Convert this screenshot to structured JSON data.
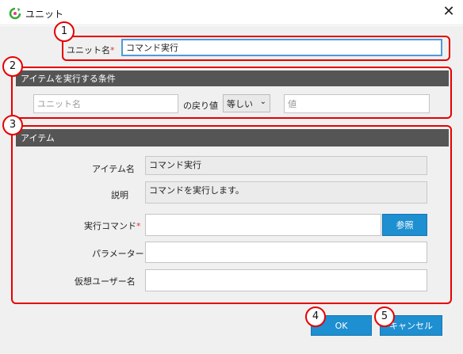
{
  "window": {
    "title": "ユニット",
    "close_glyph": "✕",
    "icon": "refresh-icon",
    "accent_color": "#1e8fd0",
    "callout_color": "#e60000",
    "header_color": "#555555"
  },
  "unit": {
    "name_label": "ユニット名",
    "required_mark": "*",
    "name_value": "コマンド実行"
  },
  "condition_section": {
    "title": "アイテムを実行する条件",
    "unit_name_placeholder": "ユニット名",
    "return_value_label": "の戻り値",
    "operator_value": "等しい",
    "operator_chevron": "⌄",
    "value_placeholder": "値"
  },
  "item_section": {
    "title": "アイテム",
    "item_name_label": "アイテム名",
    "item_name_value": "コマンド実行",
    "description_label": "説明",
    "description_value": "コマンドを実行します。",
    "command_label": "実行コマンド",
    "required_mark": "*",
    "command_value": "",
    "browse_button": "参照",
    "parameter_label": "パラメーター",
    "parameter_value": "",
    "virtual_user_label": "仮想ユーザー名",
    "virtual_user_value": ""
  },
  "footer": {
    "ok_button": "OK",
    "cancel_button": "キャンセル"
  },
  "callouts": [
    "1",
    "2",
    "3",
    "4",
    "5"
  ]
}
